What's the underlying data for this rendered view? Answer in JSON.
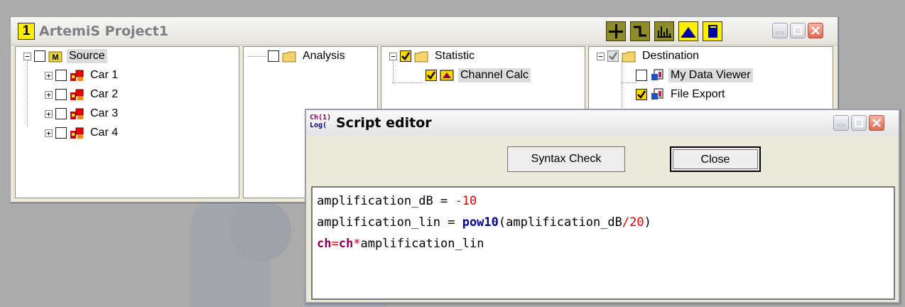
{
  "main_window": {
    "number_badge": "1",
    "title": "ArtemiS Project1",
    "toolbar": [
      "crosshair-icon",
      "step-icon",
      "spectrum-icon",
      "peak-icon",
      "document-icon"
    ],
    "accent_color": "#8e8b2a"
  },
  "panes": {
    "source": {
      "root_label": "Source",
      "root_badge": "M",
      "items": [
        "Car 1",
        "Car 2",
        "Car 3",
        "Car 4"
      ]
    },
    "analysis": {
      "root_label": "Analysis"
    },
    "statistic": {
      "root_label": "Statistic",
      "items": [
        "Channel Calc"
      ]
    },
    "destination": {
      "root_label": "Destination",
      "items": [
        "My Data Viewer",
        "File Export"
      ]
    }
  },
  "script_editor": {
    "title": "Script editor",
    "app_icon_line1": "Ch(1)",
    "app_icon_line2": "Log(",
    "syntax_check_label": "Syntax Check",
    "close_label": "Close",
    "code": {
      "line1_var": "amplification_dB = ",
      "line1_num": "-10",
      "line2_var": "amplification_lin = ",
      "line2_fn": "pow10",
      "line2_arg": "(amplification_dB",
      "line2_op": "/",
      "line2_num": "20",
      "line2_end": ")",
      "line3_ch1": "ch",
      "line3_eq": "=",
      "line3_ch2": "ch",
      "line3_op": "*",
      "line3_rest": "amplification_lin"
    }
  }
}
